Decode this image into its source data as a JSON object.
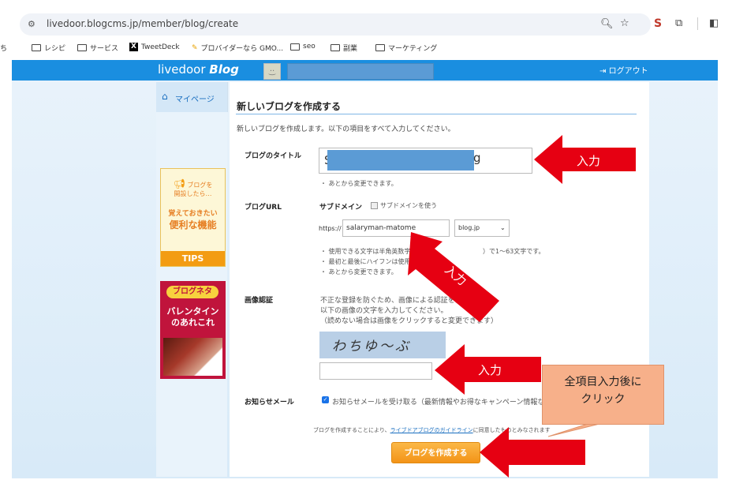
{
  "browser": {
    "url": "livedoor.blogcms.jp/member/blog/create",
    "bookmarks": [
      "ち",
      "レシピ",
      "サービス",
      "TweetDeck",
      "プロバイダーなら GMO...",
      "seo",
      "副業",
      "マーケティング"
    ]
  },
  "header": {
    "logo_main": "livedoor",
    "logo_sub": "Blog",
    "logout": "ログアウト"
  },
  "sidebar": {
    "mypage": "マイページ",
    "tips_banner": {
      "line1": "ブログを",
      "line2": "開設したら…",
      "line3": "覚えておきたい",
      "line4": "便利な機能",
      "footer": "TIPS"
    },
    "valentine_banner": {
      "tag": "ブログネタ",
      "line1": "バレンタイン",
      "line2": "のあれこれ"
    }
  },
  "form": {
    "title": "新しいブログを作成する",
    "lead": "新しいブログを作成します。以下の項目をすべて入力してください。",
    "blog_title": {
      "label": "ブログのタイトル",
      "value_start": "S",
      "value_end": "g",
      "note": "・ あとから変更できます。"
    },
    "blog_url": {
      "label": "ブログURL",
      "subdomain_label": "サブドメイン",
      "subdomain_option": "サブドメインを使う",
      "prefix": "https://",
      "subdomain_value": "salaryman-matome",
      "domain_value": "blog.jp",
      "notes": [
        "・ 使用できる文字は半角英数字",
        "・ 最初と最後にハイフンは使用",
        "・ あとから変更できます。"
      ],
      "note_tail": "）で1〜63文字です。"
    },
    "captcha": {
      "label": "画像認証",
      "desc1": "不正な登録を防ぐため、画像による認証を行い",
      "desc2": "以下の画像の文字を入力してください。",
      "desc3": "（読めない場合は画像をクリックすると変更できます）",
      "image_text": "わちゆ〜ぶ"
    },
    "notify": {
      "label": "お知らせメール",
      "checkbox_text": "お知らせメールを受け取る（最新情報やお得なキャンペーン情報な"
    },
    "terms_prefix": "ブログを作成することにより、",
    "terms_link": "ライブドアブログのガイドライン",
    "terms_suffix": "に同意したものとみなされます",
    "submit": "ブログを作成する"
  },
  "annotations": {
    "input1": "入力",
    "input2": "入力",
    "input3": "入力",
    "callout_line1": "全項目入力後に",
    "callout_line2": "クリック",
    "arrow_color": "#e60012"
  }
}
